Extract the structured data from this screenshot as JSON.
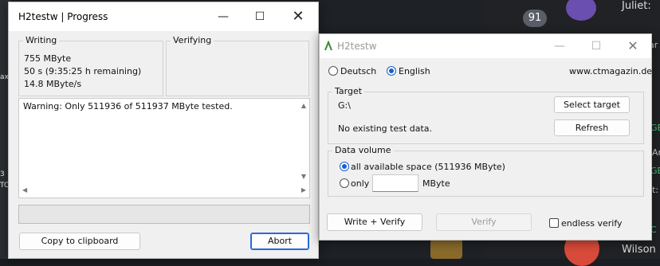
{
  "background": {
    "badge_count": "91",
    "names": [
      "Juliet:",
      "Wilson"
    ],
    "left_tags": [
      "ax",
      "3",
      "TC"
    ],
    "right_tags": [
      "ar",
      "GE",
      "Ar",
      "GE",
      "t:",
      "C"
    ]
  },
  "progress_window": {
    "title": "H2testw | Progress",
    "writing_label": "Writing",
    "verifying_label": "Verifying",
    "written": "755 MByte",
    "remaining": "50 s (9:35:25 h remaining)",
    "speed": "14.8 MByte/s",
    "log_text": "Warning: Only 511936 of 511937 MByte tested.",
    "progress_fraction": 0,
    "copy_button": "Copy to clipboard",
    "abort_button": "Abort"
  },
  "main_window": {
    "title": "H2testw",
    "lang_deutsch": "Deutsch",
    "lang_english": "English",
    "website": "www.ctmagazin.de",
    "target_label": "Target",
    "target_path": "G:\\",
    "select_target_button": "Select target",
    "test_data_status": "No existing test data.",
    "refresh_button": "Refresh",
    "data_volume_label": "Data volume",
    "all_space_option": "all available space (511936 MByte)",
    "only_option": "only",
    "only_value": "",
    "mbyte_unit": "MByte",
    "write_verify_button": "Write + Verify",
    "verify_button": "Verify",
    "endless_verify_label": "endless verify"
  },
  "colors": {
    "accent": "#1a5fd0",
    "window_bg": "#f0f0f0",
    "titlebar_bg": "#ffffff",
    "desktop_bg": "#1e2126"
  }
}
